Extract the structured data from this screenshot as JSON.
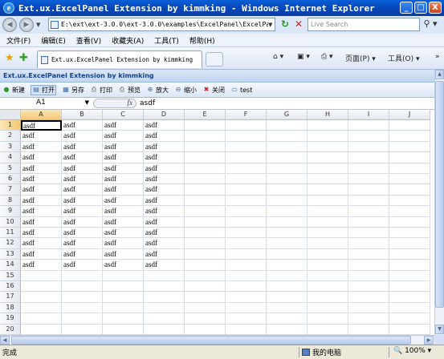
{
  "window": {
    "title": "Ext.ux.ExcelPanel Extension by kimmking - Windows Internet Explorer",
    "minimize": "_",
    "maximize": "□",
    "close": "X"
  },
  "address_bar": {
    "url": "E:\\ext\\ext-3.0.0\\ext-3.0.0\\examples\\ExcelPanel\\ExcelPanel.ht",
    "search_placeholder": "Live Search"
  },
  "menu": [
    "文件(F)",
    "编辑(E)",
    "查看(V)",
    "收藏夹(A)",
    "工具(T)",
    "帮助(H)"
  ],
  "tab": {
    "title": "Ext.ux.ExcelPanel Extension by kimmking"
  },
  "commands": {
    "home": "⌂ ▾",
    "feeds": "▣ ▾",
    "print": "⎙ ▾",
    "page": "页面(P) ▾",
    "tools": "工具(O) ▾",
    "help": "»"
  },
  "panel": {
    "title": "Ext.ux.ExcelPanel Extension by kimmking"
  },
  "toolbar": [
    {
      "label": "新建",
      "icon": "new-icon",
      "glyph": "●",
      "color": "#2a9a2a"
    },
    {
      "label": "打开",
      "icon": "open-icon",
      "glyph": "▤",
      "color": "#3a6fb0",
      "pressed": true
    },
    {
      "label": "另存",
      "icon": "save-as-icon",
      "glyph": "▦",
      "color": "#3a6fb0"
    },
    {
      "label": "打印",
      "icon": "print-icon",
      "glyph": "⎙",
      "color": "#555555"
    },
    {
      "label": "预览",
      "icon": "preview-icon",
      "glyph": "⎙",
      "color": "#555555"
    },
    {
      "label": "放大",
      "icon": "zoom-in-icon",
      "glyph": "⊕",
      "color": "#3a6fb0"
    },
    {
      "label": "缩小",
      "icon": "zoom-out-icon",
      "glyph": "⊖",
      "color": "#3a6fb0"
    },
    {
      "label": "关闭",
      "icon": "close-icon",
      "glyph": "✖",
      "color": "#d02020"
    },
    {
      "label": "test",
      "icon": "test-icon",
      "glyph": "▭",
      "color": "#3a6fb0"
    }
  ],
  "formula_bar": {
    "cell_ref": "A1",
    "fx": "fx",
    "value": "asdf"
  },
  "sheet": {
    "columns": [
      "A",
      "B",
      "C",
      "D",
      "E",
      "F",
      "G",
      "H",
      "I",
      "J"
    ],
    "rows": [
      "1",
      "2",
      "3",
      "4",
      "5",
      "6",
      "7",
      "8",
      "9",
      "10",
      "11",
      "12",
      "13",
      "14",
      "15",
      "16",
      "17",
      "18",
      "19",
      "20"
    ],
    "cells": [
      [
        "asdf",
        "asdf",
        "asdf",
        "asdf"
      ],
      [
        "asdf",
        "asdf",
        "asdf",
        "asdf"
      ],
      [
        "asdf",
        "asdf",
        "asdf",
        "asdf"
      ],
      [
        "asdf",
        "asdf",
        "asdf",
        "asdf"
      ],
      [
        "asdf",
        "asdf",
        "asdf",
        "asdf"
      ],
      [
        "asdf",
        "asdf",
        "asdf",
        "asdf"
      ],
      [
        "asdf",
        "asdf",
        "asdf",
        "asdf"
      ],
      [
        "asdf",
        "asdf",
        "asdf",
        "asdf"
      ],
      [
        "asdf",
        "asdf",
        "asdf",
        "asdf"
      ],
      [
        "asdf",
        "asdf",
        "asdf",
        "asdf"
      ],
      [
        "asdf",
        "asdf",
        "asdf",
        "asdf"
      ],
      [
        "asdf",
        "asdf",
        "asdf",
        "asdf"
      ],
      [
        "asdf",
        "asdf",
        "asdf",
        "asdf"
      ],
      [
        "asdf",
        "asdf",
        "asdf",
        "asdf"
      ]
    ],
    "active_cell": "A1"
  },
  "status_bar": {
    "status": "完成",
    "zone": "我的电脑",
    "zoom": "100%"
  }
}
